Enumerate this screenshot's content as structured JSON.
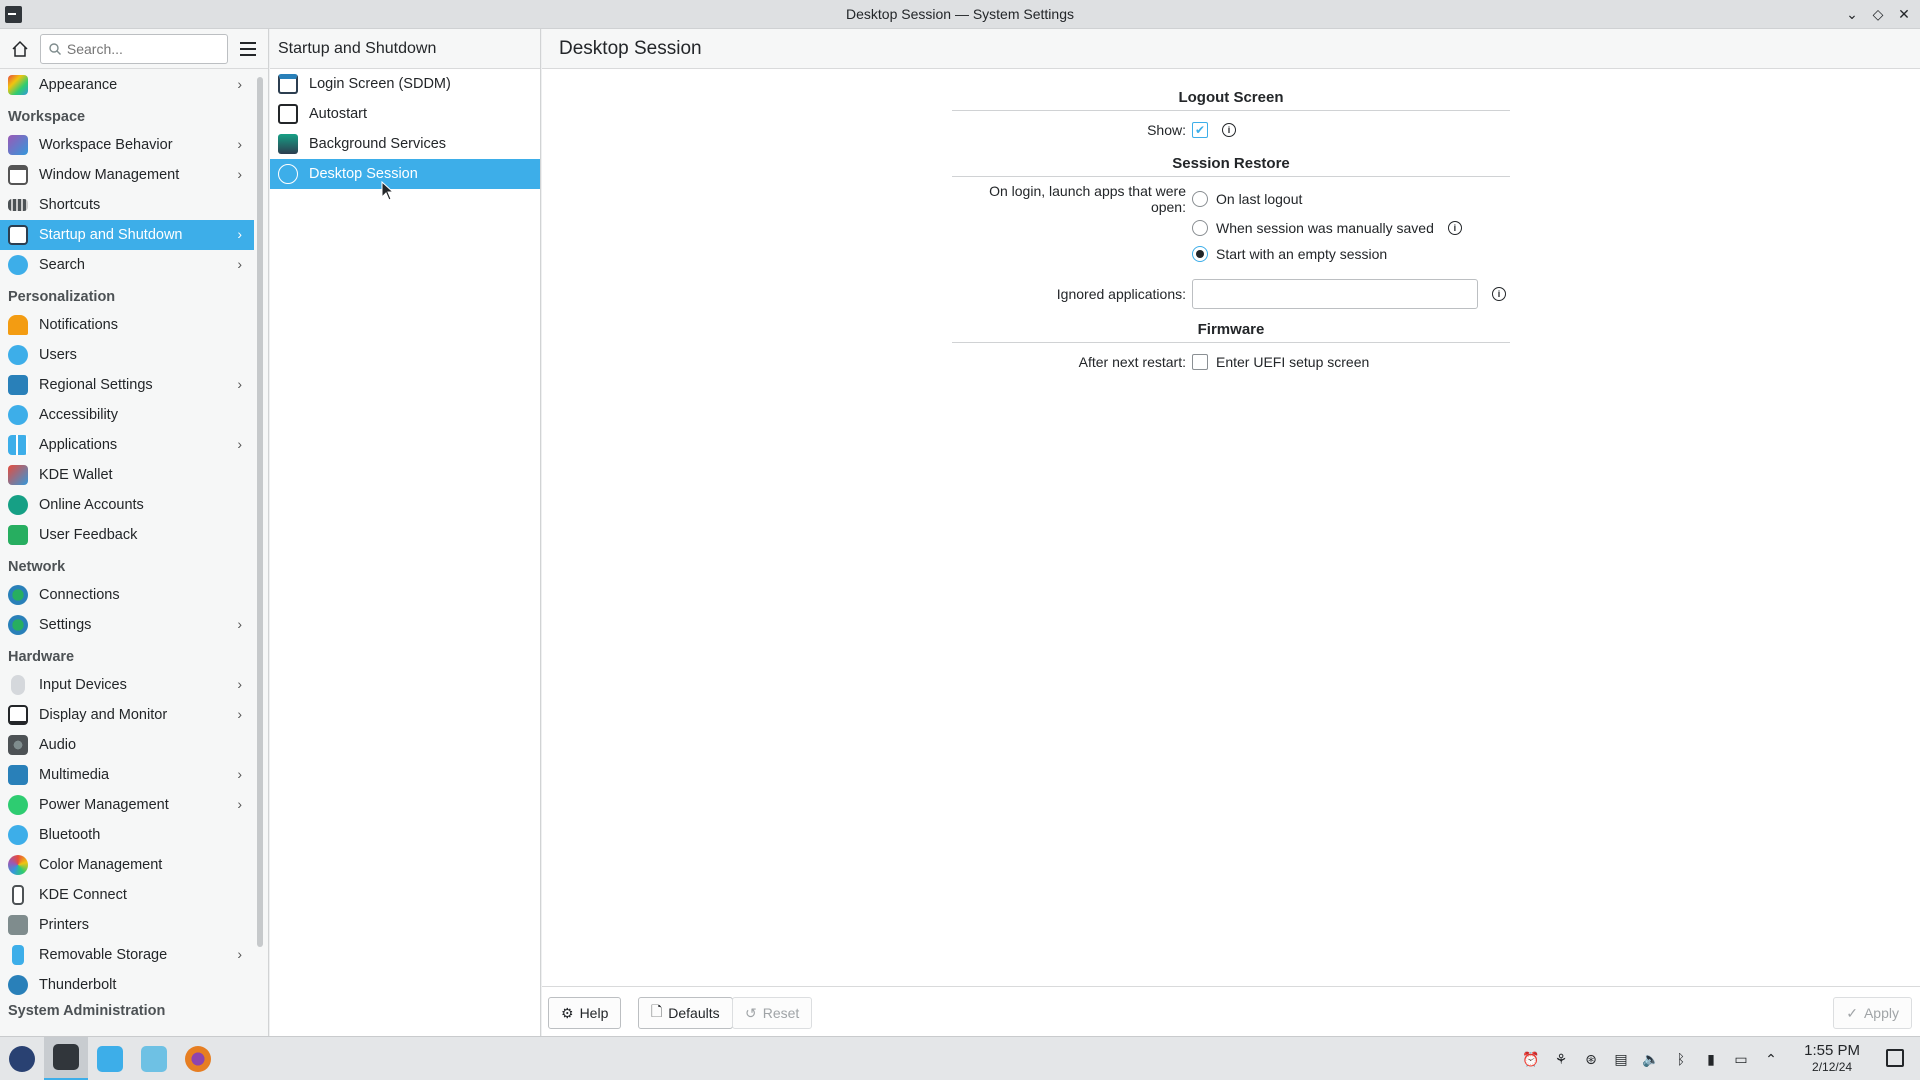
{
  "window": {
    "title": "Desktop Session — System Settings",
    "controls": {
      "minimize": "⌄",
      "maximize": "◇",
      "close": "✕"
    }
  },
  "sidebar": {
    "search_placeholder": "Search...",
    "top_item": {
      "label": "Appearance",
      "icon": "appearance-icon"
    },
    "categories": {
      "workspace": "Workspace",
      "personalization": "Personalization",
      "network": "Network",
      "hardware": "Hardware",
      "sysadmin": "System Administration"
    },
    "workspace_items": [
      {
        "label": "Workspace Behavior",
        "chev": "›"
      },
      {
        "label": "Window Management",
        "chev": "›"
      },
      {
        "label": "Shortcuts",
        "chev": ""
      },
      {
        "label": "Startup and Shutdown",
        "chev": "›"
      },
      {
        "label": "Search",
        "chev": "›"
      }
    ],
    "personalization_items": [
      {
        "label": "Notifications",
        "chev": ""
      },
      {
        "label": "Users",
        "chev": ""
      },
      {
        "label": "Regional Settings",
        "chev": "›"
      },
      {
        "label": "Accessibility",
        "chev": ""
      },
      {
        "label": "Applications",
        "chev": "›"
      },
      {
        "label": "KDE Wallet",
        "chev": ""
      },
      {
        "label": "Online Accounts",
        "chev": ""
      },
      {
        "label": "User Feedback",
        "chev": ""
      }
    ],
    "network_items": [
      {
        "label": "Connections",
        "chev": ""
      },
      {
        "label": "Settings",
        "chev": "›"
      }
    ],
    "hardware_items": [
      {
        "label": "Input Devices",
        "chev": "›"
      },
      {
        "label": "Display and Monitor",
        "chev": "›"
      },
      {
        "label": "Audio",
        "chev": ""
      },
      {
        "label": "Multimedia",
        "chev": "›"
      },
      {
        "label": "Power Management",
        "chev": "›"
      },
      {
        "label": "Bluetooth",
        "chev": ""
      },
      {
        "label": "Color Management",
        "chev": ""
      },
      {
        "label": "KDE Connect",
        "chev": ""
      },
      {
        "label": "Printers",
        "chev": ""
      },
      {
        "label": "Removable Storage",
        "chev": "›"
      },
      {
        "label": "Thunderbolt",
        "chev": ""
      }
    ]
  },
  "middle": {
    "title": "Startup and Shutdown",
    "items": [
      {
        "label": "Login Screen (SDDM)"
      },
      {
        "label": "Autostart"
      },
      {
        "label": "Background Services"
      },
      {
        "label": "Desktop Session"
      }
    ]
  },
  "main": {
    "title": "Desktop Session",
    "logout": {
      "title": "Logout Screen",
      "show_label": "Show:",
      "show_checked": true
    },
    "restore": {
      "title": "Session Restore",
      "label": "On login, launch apps that were open:",
      "options": [
        "On last logout",
        "When session was manually saved",
        "Start with an empty session"
      ],
      "selected": "Start with an empty session",
      "ignored_label": "Ignored applications:",
      "ignored_value": ""
    },
    "firmware": {
      "title": "Firmware",
      "label": "After next restart:",
      "option": "Enter UEFI setup screen",
      "checked": false
    },
    "buttons": {
      "help": "Help",
      "defaults": "Defaults",
      "reset": "Reset",
      "apply": "Apply"
    }
  },
  "taskbar": {
    "time": "1:55 PM",
    "date": "2/12/24"
  },
  "colors": {
    "accent": "#3daee9"
  }
}
